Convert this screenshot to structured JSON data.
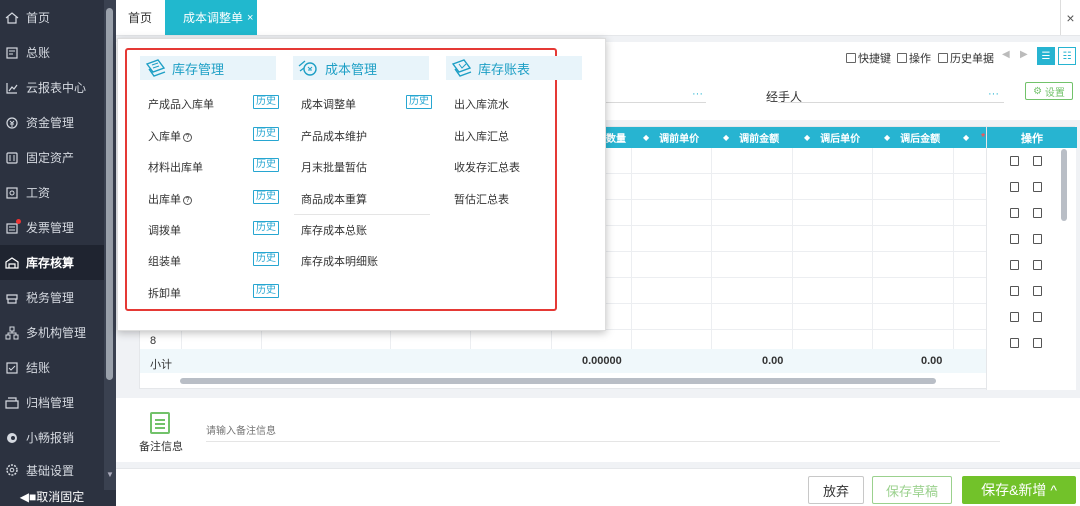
{
  "sidebar": {
    "items": [
      {
        "label": "首页",
        "icon": "home-icon"
      },
      {
        "label": "总账",
        "icon": "ledger-icon"
      },
      {
        "label": "云报表中心",
        "icon": "chart-icon"
      },
      {
        "label": "资金管理",
        "icon": "money-icon"
      },
      {
        "label": "固定资产",
        "icon": "asset-icon"
      },
      {
        "label": "工资",
        "icon": "salary-icon"
      },
      {
        "label": "发票管理",
        "icon": "invoice-icon"
      },
      {
        "label": "库存核算",
        "icon": "warehouse-icon"
      },
      {
        "label": "税务管理",
        "icon": "tax-icon"
      },
      {
        "label": "多机构管理",
        "icon": "org-icon"
      },
      {
        "label": "结账",
        "icon": "close-account-icon"
      },
      {
        "label": "归档管理",
        "icon": "archive-icon"
      },
      {
        "label": "小畅报销",
        "icon": "expense-icon"
      },
      {
        "label": "基础设置",
        "icon": "settings-icon"
      }
    ],
    "active": "库存核算",
    "unpin_label": "◀■取消固定"
  },
  "tabs": {
    "home": "首页",
    "active": "成本调整单",
    "close_glyph": "×"
  },
  "window_close": "×",
  "toolbar": {
    "shortcut": "快捷键",
    "operation": "操作",
    "history": "历史单据"
  },
  "form": {
    "handler_label": "经手人",
    "settings_label": "设置",
    "dots": "···"
  },
  "table": {
    "headers": [
      "数量",
      "调前单价",
      "调前金额",
      "调后单价",
      "调后金额",
      ""
    ],
    "op_header": "操作",
    "row8": "8",
    "subtotal_label": "小计",
    "subtotal_values": [
      "0.00000",
      "0.00",
      "0.00"
    ]
  },
  "remark": {
    "label": "备注信息",
    "placeholder": "请输入备注信息"
  },
  "bottom": {
    "cancel": "放弃",
    "draft": "保存草稿",
    "save_new": "保存&新增 ^"
  },
  "menu": {
    "inventory_mgmt": {
      "title": "库存管理",
      "items": [
        {
          "label": "产成品入库单",
          "history": "历史"
        },
        {
          "label": "入库单",
          "history": "历史",
          "help": "?"
        },
        {
          "label": "材料出库单",
          "history": "历史"
        },
        {
          "label": "出库单",
          "history": "历史",
          "help": "?"
        },
        {
          "label": "调拨单",
          "history": "历史"
        },
        {
          "label": "组装单",
          "history": "历史"
        },
        {
          "label": "拆卸单",
          "history": "历史"
        }
      ]
    },
    "cost_mgmt": {
      "title": "成本管理",
      "items": [
        {
          "label": "成本调整单",
          "history": "历史"
        },
        {
          "label": "产品成本维护"
        },
        {
          "label": "月末批量暂估"
        },
        {
          "label": "商品成本重算"
        },
        {
          "label": "库存成本总账"
        },
        {
          "label": "库存成本明细账"
        }
      ]
    },
    "inventory_ledger": {
      "title": "库存账表",
      "items": [
        {
          "label": "出入库流水"
        },
        {
          "label": "出入库汇总"
        },
        {
          "label": "收发存汇总表"
        },
        {
          "label": "暂估汇总表"
        }
      ]
    }
  }
}
